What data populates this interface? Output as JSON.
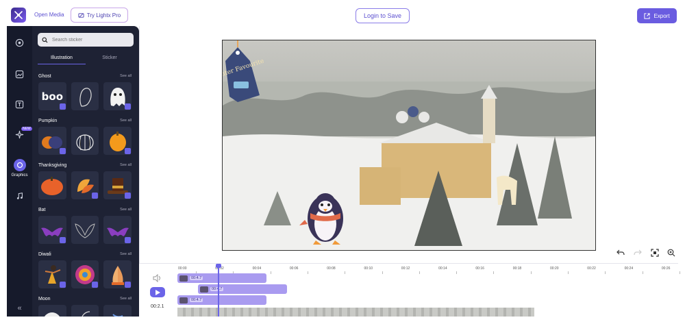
{
  "topbar": {
    "open_media_label": "Open Media",
    "try_pro_label": "Try Lightx Pro",
    "login_label": "Login to Save",
    "export_label": "Export"
  },
  "rail": {
    "new_badge": "NEW",
    "active_label": "Graphics",
    "collapse_glyph": "«"
  },
  "panel": {
    "search_placeholder": "Search sticker",
    "tabs": [
      "Illustration",
      "Sticker"
    ],
    "see_all_label": "See all",
    "sections": [
      {
        "title": "Ghost"
      },
      {
        "title": "Pumpkin"
      },
      {
        "title": "Thanksgiving"
      },
      {
        "title": "Bat"
      },
      {
        "title": "Diwali"
      },
      {
        "title": "Moon"
      }
    ],
    "ghost_text": "boo"
  },
  "canvas": {
    "sticker_text": "Winter Favourite"
  },
  "timeline": {
    "ticks": [
      "00:00",
      "00:02",
      "00:04",
      "00:06",
      "00:08",
      "00:10",
      "00:12",
      "00:14",
      "00:16",
      "00:18",
      "00:20",
      "00:22",
      "00:24",
      "00:26"
    ],
    "clip_duration": "00:4.7",
    "current_time": "00:2.1"
  },
  "colors": {
    "accent": "#6b64e8",
    "rail_bg": "#161a2b",
    "panel_bg": "#1e2234",
    "clip": "#a99bf0"
  }
}
